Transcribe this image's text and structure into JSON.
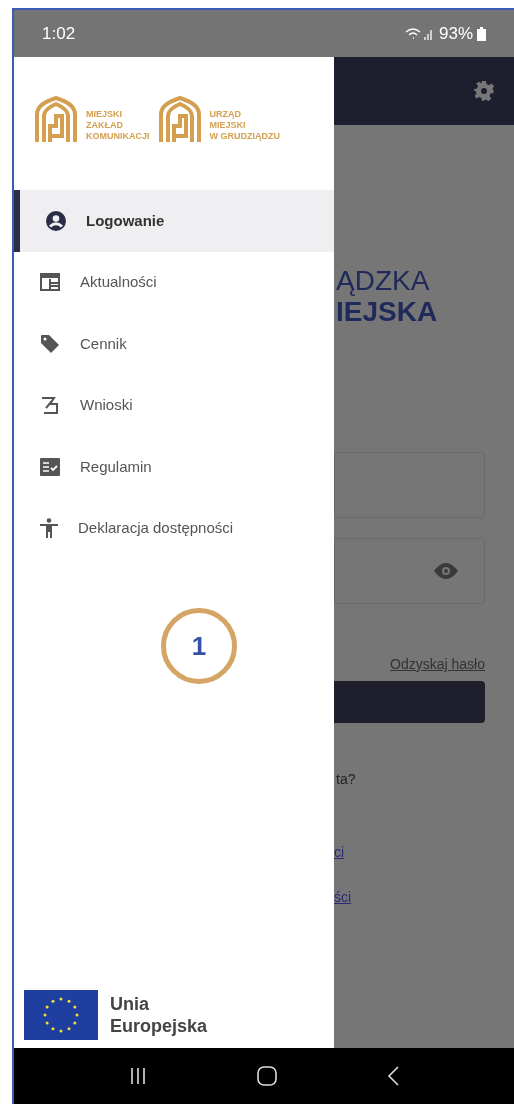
{
  "status_bar": {
    "time": "1:02",
    "battery": "93%"
  },
  "drawer": {
    "logos": [
      {
        "lines": [
          "MIEJSKI",
          "ZAKŁAD",
          "KOMUNIKACJI"
        ]
      },
      {
        "lines": [
          "URZĄD",
          "MIEJSKI",
          "W GRUDZIĄDZU"
        ]
      }
    ],
    "items": [
      {
        "label": "Logowanie",
        "kind": "account",
        "selected": true
      },
      {
        "label": "Aktualności",
        "kind": "news",
        "selected": false
      },
      {
        "label": "Cennik",
        "kind": "tag",
        "selected": false
      },
      {
        "label": "Wnioski",
        "kind": "forms",
        "selected": false
      },
      {
        "label": "Regulamin",
        "kind": "rules",
        "selected": false
      },
      {
        "label": "Deklaracja dostępności",
        "kind": "accessibility",
        "selected": false
      }
    ],
    "footer": {
      "lines": [
        "Unia",
        "Europejska"
      ]
    }
  },
  "annotation": "1",
  "background_page": {
    "title_lines": [
      "ĄDZKA",
      "IEJSKA"
    ],
    "recover_link": "Odzyskaj hasło",
    "question": "ta?",
    "links": [
      "ci",
      "ści"
    ]
  }
}
